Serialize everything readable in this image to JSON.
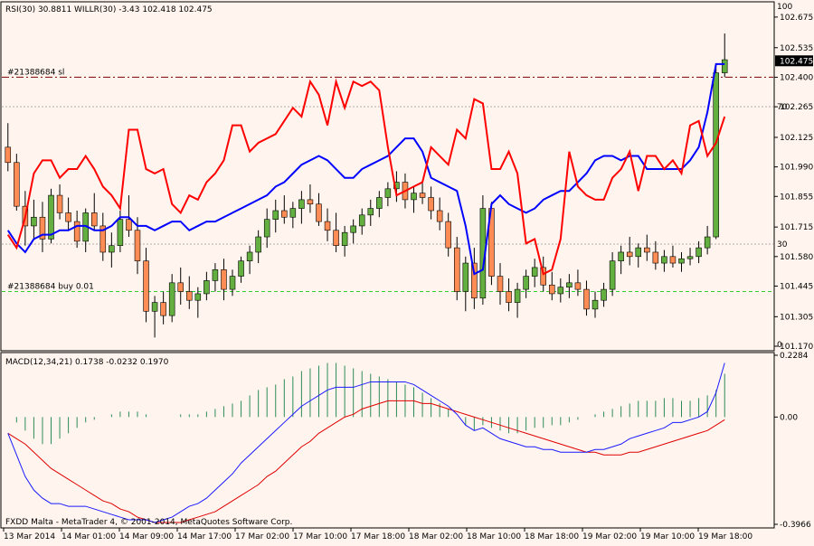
{
  "theme": {
    "background": "#fff5ee",
    "bull_candle": "#63b040",
    "bear_candle": "#ff8c55",
    "candle_outline": "#000000",
    "red_line": "#ff0000",
    "blue_line": "#0000ff",
    "sl_line": "#800000",
    "buy_line": "#32cd32",
    "grid": "#b0b0b0",
    "macd_hist": "#2e8b57",
    "macd_signal": "#e00000",
    "macd_line": "#1a1aff",
    "price_marker_bg": "#000000",
    "price_marker_fg": "#ffffff"
  },
  "header_text": "RSI(30) 30.8811 WILLR(30) -3.43 102.418 102.475",
  "footer_text": "FXDD Malta - MetaTrader 4, © 2001-2014, MetaQuotes Software Corp.",
  "chart_data": [
    {
      "type": "candlestick",
      "symbol": "USDJPY",
      "timeframe": "H1",
      "ylim": [
        101.17,
        102.72
      ],
      "y_ticks": [
        "102.675",
        "102.535",
        "102.400",
        "102.265",
        "102.125",
        "101.990",
        "101.855",
        "101.715",
        "101.580",
        "101.445",
        "101.305",
        "101.170"
      ],
      "current_price": "102.475",
      "indicator_scale_labels": [
        "100",
        "70",
        "30",
        "0"
      ],
      "levels": [
        {
          "label": "#21388684 sl",
          "price": 102.4
        },
        {
          "label": "#21388684 buy 0.01",
          "price": 101.42
        }
      ],
      "candles_ohlc": [
        [
          102.08,
          102.19,
          101.97,
          102.01
        ],
        [
          102.01,
          102.05,
          101.79,
          101.81
        ],
        [
          101.81,
          101.88,
          101.63,
          101.72
        ],
        [
          101.72,
          101.84,
          101.66,
          101.76
        ],
        [
          101.76,
          101.83,
          101.6,
          101.66
        ],
        [
          101.66,
          101.89,
          101.64,
          101.86
        ],
        [
          101.86,
          101.91,
          101.75,
          101.78
        ],
        [
          101.78,
          101.85,
          101.7,
          101.74
        ],
        [
          101.74,
          101.79,
          101.62,
          101.65
        ],
        [
          101.65,
          101.8,
          101.6,
          101.78
        ],
        [
          101.78,
          101.87,
          101.7,
          101.72
        ],
        [
          101.72,
          101.78,
          101.56,
          101.6
        ],
        [
          101.6,
          101.69,
          101.53,
          101.63
        ],
        [
          101.63,
          101.79,
          101.6,
          101.75
        ],
        [
          101.75,
          101.86,
          101.67,
          101.7
        ],
        [
          101.7,
          101.76,
          101.5,
          101.56
        ],
        [
          101.56,
          101.62,
          101.28,
          101.33
        ],
        [
          101.33,
          101.4,
          101.21,
          101.37
        ],
        [
          101.37,
          101.42,
          101.27,
          101.31
        ],
        [
          101.31,
          101.5,
          101.28,
          101.46
        ],
        [
          101.46,
          101.53,
          101.36,
          101.42
        ],
        [
          101.42,
          101.49,
          101.34,
          101.38
        ],
        [
          101.38,
          101.44,
          101.3,
          101.41
        ],
        [
          101.41,
          101.51,
          101.38,
          101.47
        ],
        [
          101.47,
          101.55,
          101.42,
          101.52
        ],
        [
          101.52,
          101.57,
          101.38,
          101.43
        ],
        [
          101.43,
          101.52,
          101.4,
          101.49
        ],
        [
          101.49,
          101.58,
          101.46,
          101.56
        ],
        [
          101.56,
          101.63,
          101.5,
          101.6
        ],
        [
          101.6,
          101.7,
          101.55,
          101.67
        ],
        [
          101.67,
          101.8,
          101.62,
          101.75
        ],
        [
          101.75,
          101.84,
          101.69,
          101.79
        ],
        [
          101.79,
          101.86,
          101.73,
          101.76
        ],
        [
          101.76,
          101.83,
          101.71,
          101.8
        ],
        [
          101.8,
          101.88,
          101.73,
          101.84
        ],
        [
          101.84,
          101.91,
          101.78,
          101.82
        ],
        [
          101.82,
          101.87,
          101.72,
          101.74
        ],
        [
          101.74,
          101.8,
          101.65,
          101.7
        ],
        [
          101.7,
          101.78,
          101.6,
          101.63
        ],
        [
          101.63,
          101.72,
          101.58,
          101.69
        ],
        [
          101.69,
          101.75,
          101.64,
          101.72
        ],
        [
          101.72,
          101.8,
          101.68,
          101.77
        ],
        [
          101.77,
          101.84,
          101.72,
          101.8
        ],
        [
          101.8,
          101.88,
          101.76,
          101.85
        ],
        [
          101.85,
          101.92,
          101.81,
          101.89
        ],
        [
          101.89,
          101.97,
          101.83,
          101.92
        ],
        [
          101.92,
          101.96,
          101.8,
          101.84
        ],
        [
          101.84,
          101.9,
          101.78,
          101.87
        ],
        [
          101.87,
          101.93,
          101.82,
          101.85
        ],
        [
          101.85,
          101.9,
          101.75,
          101.79
        ],
        [
          101.79,
          101.85,
          101.7,
          101.74
        ],
        [
          101.74,
          101.78,
          101.58,
          101.62
        ],
        [
          101.62,
          101.67,
          101.38,
          101.42
        ],
        [
          101.42,
          101.58,
          101.33,
          101.55
        ],
        [
          101.55,
          101.62,
          101.34,
          101.39
        ],
        [
          101.39,
          101.86,
          101.36,
          101.8
        ],
        [
          101.8,
          101.83,
          101.45,
          101.49
        ],
        [
          101.49,
          101.55,
          101.36,
          101.42
        ],
        [
          101.42,
          101.48,
          101.33,
          101.37
        ],
        [
          101.37,
          101.46,
          101.3,
          101.43
        ],
        [
          101.43,
          101.52,
          101.39,
          101.49
        ],
        [
          101.49,
          101.57,
          101.44,
          101.53
        ],
        [
          101.53,
          101.58,
          101.42,
          101.45
        ],
        [
          101.45,
          101.51,
          101.38,
          101.41
        ],
        [
          101.41,
          101.48,
          101.37,
          101.44
        ],
        [
          101.44,
          101.5,
          101.39,
          101.46
        ],
        [
          101.46,
          101.52,
          101.4,
          101.43
        ],
        [
          101.43,
          101.47,
          101.31,
          101.34
        ],
        [
          101.34,
          101.42,
          101.3,
          101.38
        ],
        [
          101.38,
          101.46,
          101.35,
          101.43
        ],
        [
          101.43,
          101.6,
          101.4,
          101.56
        ],
        [
          101.56,
          101.63,
          101.5,
          101.6
        ],
        [
          101.6,
          101.67,
          101.54,
          101.58
        ],
        [
          101.58,
          101.64,
          101.53,
          101.62
        ],
        [
          101.62,
          101.68,
          101.56,
          101.6
        ],
        [
          101.6,
          101.65,
          101.52,
          101.55
        ],
        [
          101.55,
          101.61,
          101.51,
          101.58
        ],
        [
          101.58,
          101.63,
          101.53,
          101.55
        ],
        [
          101.55,
          101.6,
          101.51,
          101.57
        ],
        [
          101.57,
          101.62,
          101.54,
          101.58
        ],
        [
          101.58,
          101.65,
          101.55,
          101.62
        ],
        [
          101.62,
          101.72,
          101.59,
          101.67
        ],
        [
          101.67,
          102.45,
          101.66,
          102.42
        ],
        [
          102.42,
          102.6,
          102.4,
          102.48
        ]
      ],
      "red_line": [
        101.68,
        101.62,
        101.76,
        101.96,
        102.02,
        102.02,
        101.94,
        101.98,
        101.98,
        102.04,
        101.98,
        101.9,
        101.86,
        101.8,
        102.16,
        102.16,
        101.98,
        101.96,
        101.98,
        101.82,
        101.78,
        101.86,
        101.84,
        101.92,
        101.96,
        102.02,
        102.18,
        102.18,
        102.06,
        102.1,
        102.12,
        102.14,
        102.2,
        102.26,
        102.22,
        102.38,
        102.32,
        102.18,
        102.38,
        102.26,
        102.38,
        102.36,
        102.38,
        102.34,
        102.08,
        101.86,
        101.88,
        101.9,
        101.92,
        102.08,
        102.04,
        102.0,
        102.16,
        102.12,
        102.3,
        102.28,
        101.98,
        101.98,
        102.06,
        101.96,
        101.64,
        101.66,
        101.5,
        101.52,
        101.66,
        102.06,
        101.9,
        101.86,
        101.84,
        101.84,
        101.94,
        101.98,
        102.06,
        101.88,
        102.04,
        102.04,
        101.98,
        102.02,
        101.96,
        102.18,
        102.2,
        102.04,
        102.1,
        102.22
      ],
      "blue_line": [
        101.7,
        101.64,
        101.6,
        101.66,
        101.68,
        101.68,
        101.7,
        101.7,
        101.72,
        101.72,
        101.7,
        101.7,
        101.72,
        101.76,
        101.76,
        101.72,
        101.72,
        101.7,
        101.72,
        101.74,
        101.74,
        101.7,
        101.72,
        101.74,
        101.74,
        101.76,
        101.78,
        101.8,
        101.82,
        101.84,
        101.86,
        101.9,
        101.92,
        101.96,
        102.0,
        102.02,
        102.04,
        102.02,
        101.98,
        101.94,
        101.94,
        101.98,
        102.0,
        102.02,
        102.04,
        102.08,
        102.12,
        102.12,
        102.06,
        101.94,
        101.92,
        101.9,
        101.88,
        101.72,
        101.5,
        101.52,
        101.82,
        101.86,
        101.82,
        101.8,
        101.78,
        101.8,
        101.84,
        101.86,
        101.88,
        101.88,
        101.92,
        101.96,
        102.02,
        102.04,
        102.04,
        102.02,
        102.04,
        102.04,
        101.98,
        101.98,
        101.98,
        101.98,
        101.98,
        102.02,
        102.08,
        102.24,
        102.46,
        102.46
      ]
    },
    {
      "type": "macd",
      "title": "MACD(12,34,21) 0.1738 -0.0232 0.1970",
      "ylim": [
        -0.3966,
        0.2284
      ],
      "y_ticks": [
        "0.2284",
        "0.00",
        "-0.3966"
      ],
      "histogram": [
        0.0,
        -0.02,
        -0.05,
        -0.08,
        -0.1,
        -0.1,
        -0.08,
        -0.06,
        -0.04,
        -0.02,
        -0.01,
        0.0,
        0.01,
        0.02,
        0.02,
        0.02,
        0.01,
        0.0,
        0.0,
        0.0,
        0.01,
        0.01,
        0.01,
        0.02,
        0.03,
        0.04,
        0.05,
        0.06,
        0.08,
        0.1,
        0.11,
        0.12,
        0.14,
        0.15,
        0.17,
        0.18,
        0.19,
        0.2,
        0.2,
        0.19,
        0.18,
        0.17,
        0.16,
        0.15,
        0.14,
        0.13,
        0.12,
        0.11,
        0.09,
        0.07,
        0.05,
        0.03,
        0.0,
        -0.03,
        -0.05,
        -0.03,
        -0.04,
        -0.05,
        -0.06,
        -0.06,
        -0.05,
        -0.04,
        -0.04,
        -0.03,
        -0.03,
        -0.02,
        -0.01,
        0.0,
        0.01,
        0.02,
        0.03,
        0.04,
        0.05,
        0.06,
        0.06,
        0.06,
        0.07,
        0.07,
        0.06,
        0.06,
        0.07,
        0.08,
        0.1,
        0.16
      ],
      "signal": [
        -0.06,
        -0.08,
        -0.1,
        -0.13,
        -0.16,
        -0.19,
        -0.21,
        -0.23,
        -0.25,
        -0.27,
        -0.29,
        -0.31,
        -0.32,
        -0.34,
        -0.35,
        -0.37,
        -0.38,
        -0.39,
        -0.39,
        -0.39,
        -0.39,
        -0.38,
        -0.37,
        -0.36,
        -0.35,
        -0.33,
        -0.31,
        -0.29,
        -0.27,
        -0.25,
        -0.22,
        -0.2,
        -0.17,
        -0.14,
        -0.11,
        -0.09,
        -0.06,
        -0.04,
        -0.02,
        0.0,
        0.01,
        0.03,
        0.04,
        0.05,
        0.06,
        0.06,
        0.06,
        0.06,
        0.05,
        0.05,
        0.04,
        0.03,
        0.02,
        0.01,
        0.0,
        -0.01,
        -0.02,
        -0.03,
        -0.04,
        -0.05,
        -0.06,
        -0.07,
        -0.08,
        -0.09,
        -0.1,
        -0.11,
        -0.12,
        -0.13,
        -0.13,
        -0.14,
        -0.14,
        -0.14,
        -0.13,
        -0.13,
        -0.12,
        -0.11,
        -0.1,
        -0.09,
        -0.08,
        -0.07,
        -0.06,
        -0.05,
        -0.03,
        -0.01
      ],
      "macd": [
        -0.06,
        -0.14,
        -0.22,
        -0.27,
        -0.3,
        -0.32,
        -0.32,
        -0.33,
        -0.33,
        -0.33,
        -0.34,
        -0.35,
        -0.36,
        -0.37,
        -0.38,
        -0.38,
        -0.38,
        -0.39,
        -0.38,
        -0.37,
        -0.35,
        -0.33,
        -0.32,
        -0.3,
        -0.27,
        -0.24,
        -0.21,
        -0.17,
        -0.14,
        -0.11,
        -0.08,
        -0.05,
        -0.02,
        0.01,
        0.04,
        0.06,
        0.08,
        0.1,
        0.11,
        0.11,
        0.11,
        0.12,
        0.13,
        0.13,
        0.13,
        0.13,
        0.13,
        0.12,
        0.1,
        0.08,
        0.06,
        0.04,
        0.01,
        -0.03,
        -0.05,
        -0.04,
        -0.06,
        -0.08,
        -0.09,
        -0.1,
        -0.11,
        -0.11,
        -0.12,
        -0.12,
        -0.13,
        -0.13,
        -0.13,
        -0.13,
        -0.12,
        -0.12,
        -0.11,
        -0.1,
        -0.08,
        -0.07,
        -0.06,
        -0.05,
        -0.04,
        -0.02,
        -0.02,
        -0.01,
        0.0,
        0.02,
        0.09,
        0.2
      ]
    }
  ],
  "x_axis_labels": [
    "13 Mar 2014",
    "14 Mar 01:00",
    "14 Mar 09:00",
    "14 Mar 17:00",
    "17 Mar 02:00",
    "17 Mar 10:00",
    "17 Mar 18:00",
    "18 Mar 02:00",
    "18 Mar 10:00",
    "18 Mar 18:00",
    "19 Mar 02:00",
    "19 Mar 10:00",
    "19 Mar 18:00"
  ]
}
